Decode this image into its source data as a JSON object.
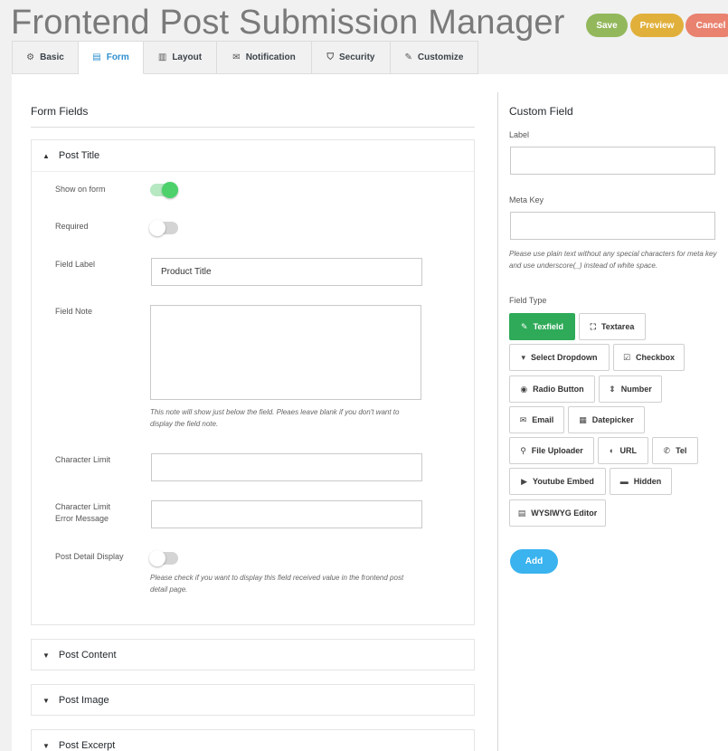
{
  "title": "Frontend Post Submission Manager",
  "header_buttons": {
    "save": "Save",
    "preview": "Preview",
    "cancel": "Cancel"
  },
  "tabs": [
    {
      "label": "Basic",
      "icon": "gear-icon",
      "glyph": "⚙"
    },
    {
      "label": "Form",
      "icon": "form-icon",
      "glyph": "▤"
    },
    {
      "label": "Layout",
      "icon": "layout-icon",
      "glyph": "▥"
    },
    {
      "label": "Notification",
      "icon": "envelope-icon",
      "glyph": "✉"
    },
    {
      "label": "Security",
      "icon": "shield-icon",
      "glyph": "⛉"
    },
    {
      "label": "Customize",
      "icon": "brush-icon",
      "glyph": "✎"
    }
  ],
  "active_tab": "Form",
  "form_fields": {
    "title": "Form Fields",
    "post_title": {
      "header": "Post Title",
      "show_on_form_label": "Show on form",
      "show_on_form": true,
      "required_label": "Required",
      "required": false,
      "field_label_label": "Field Label",
      "field_label_value": "Product Title",
      "field_note_label": "Field Note",
      "field_note_value": "",
      "field_note_help": "This note will show just below the field. Pleaes leave blank if you don't want to display the field note.",
      "char_limit_label": "Character Limit",
      "char_limit_value": "",
      "char_limit_err_label_1": "Character Limit",
      "char_limit_err_label_2": "Error Message",
      "char_limit_err_value": "",
      "post_detail_label": "Post Detail Display",
      "post_detail": false,
      "post_detail_help": "Please check if you want to display this field received value in the frontend post detail page."
    },
    "collapsed": [
      "Post Content",
      "Post Image",
      "Post Excerpt"
    ]
  },
  "custom_field": {
    "title": "Custom Field",
    "label_label": "Label",
    "label_value": "",
    "meta_key_label": "Meta Key",
    "meta_key_value": "",
    "meta_key_note": "Please use plain text without any special characters for meta key and use underscore(_) instead of white space.",
    "field_type_label": "Field Type",
    "field_types": [
      {
        "label": "Texfield",
        "icon": "edit-icon",
        "glyph": "✎",
        "selected": true
      },
      {
        "label": "Textarea",
        "icon": "expand-icon",
        "glyph": "⛶",
        "selected": false
      },
      {
        "label": "Select Dropdown",
        "icon": "dropdown-icon",
        "glyph": "▾",
        "selected": false
      },
      {
        "label": "Checkbox",
        "icon": "checkbox-icon",
        "glyph": "☑",
        "selected": false
      },
      {
        "label": "Radio Button",
        "icon": "radio-icon",
        "glyph": "◉",
        "selected": false
      },
      {
        "label": "Number",
        "icon": "sort-icon",
        "glyph": "⇕",
        "selected": false
      },
      {
        "label": "Email",
        "icon": "envelope-icon",
        "glyph": "✉",
        "selected": false
      },
      {
        "label": "Datepicker",
        "icon": "calendar-icon",
        "glyph": "▦",
        "selected": false
      },
      {
        "label": "File Uploader",
        "icon": "paperclip-icon",
        "glyph": "⚲",
        "selected": false
      },
      {
        "label": "URL",
        "icon": "globe-icon",
        "glyph": "◐",
        "selected": false
      },
      {
        "label": "Tel",
        "icon": "phone-icon",
        "glyph": "✆",
        "selected": false
      },
      {
        "label": "Youtube Embed",
        "icon": "youtube-icon",
        "glyph": "▶",
        "selected": false
      },
      {
        "label": "Hidden",
        "icon": "hidden-icon",
        "glyph": "▬",
        "selected": false
      },
      {
        "label": "WYSIWYG Editor",
        "icon": "file-icon",
        "glyph": "▤",
        "selected": false
      }
    ],
    "add_label": "Add"
  },
  "colors": {
    "save": "#93b85c",
    "preview": "#e1b03b",
    "cancel": "#e9826f",
    "active_tab": "#2f8fd0",
    "selected_type": "#2eaa58",
    "add": "#3ab3ef",
    "toggle_on": "#4cd16b"
  }
}
